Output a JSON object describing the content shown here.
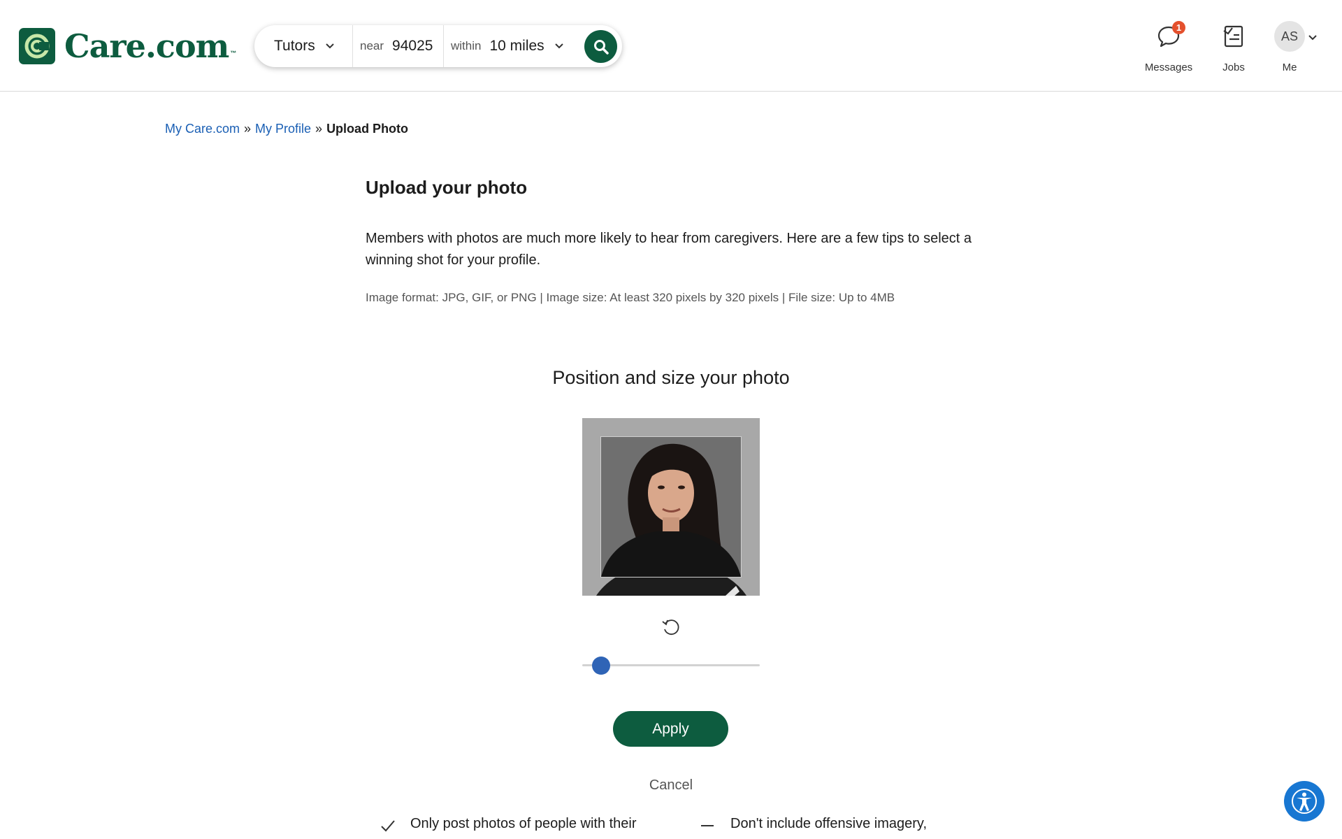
{
  "header": {
    "logo_text": "Care.com",
    "logo_tm": "™",
    "search": {
      "service": "Tutors",
      "near_label": "near",
      "zip": "94025",
      "within_label": "within",
      "distance": "10 miles"
    },
    "nav": {
      "messages_label": "Messages",
      "messages_badge": "1",
      "jobs_label": "Jobs",
      "me_label": "Me",
      "avatar_initials": "AS"
    }
  },
  "breadcrumb": {
    "items": [
      "My Care.com",
      "My Profile"
    ],
    "separator": "»",
    "current": "Upload Photo"
  },
  "main": {
    "title": "Upload your photo",
    "intro": "Members with photos are much more likely to hear from caregivers. Here are a few tips to select a winning shot for your profile.",
    "format_info": "Image format: JPG, GIF, or PNG | Image size: At least 320 pixels by 320 pixels | File size: Up to 4MB",
    "editor_title": "Position and size your photo",
    "zoom_fraction": 0.06,
    "apply_label": "Apply",
    "cancel_label": "Cancel",
    "tips": {
      "do": "Only post photos of people with their",
      "dont": "Don't include offensive imagery,"
    }
  },
  "colors": {
    "brand": "#0d5c3f",
    "link": "#1a5fb4",
    "slider": "#2f64b6",
    "badge": "#e4502d",
    "accessibility": "#1877d2"
  }
}
